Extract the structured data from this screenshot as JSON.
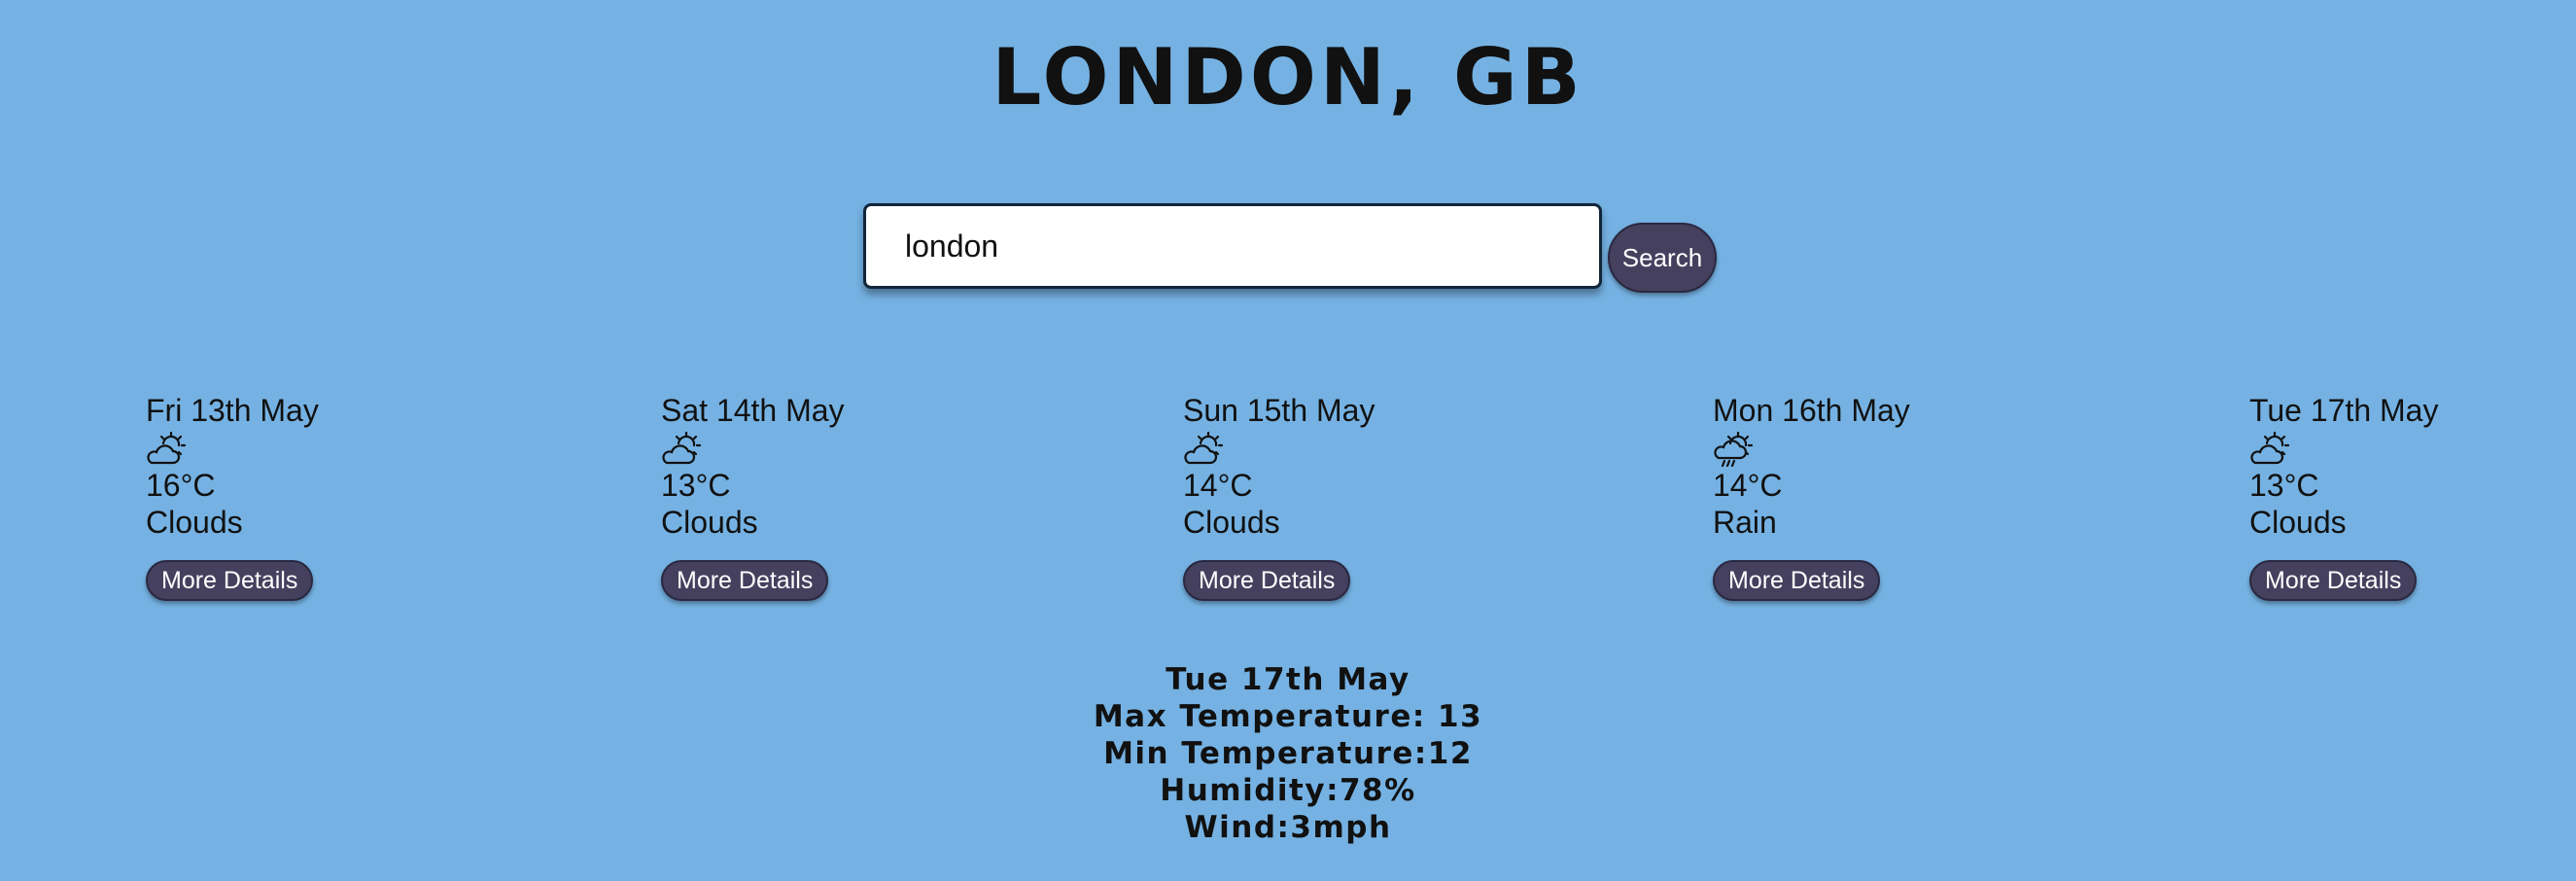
{
  "header": {
    "city_title": "LONDON, GB"
  },
  "search": {
    "value": "london",
    "button_label": "Search"
  },
  "forecast": [
    {
      "date": "Fri 13th May",
      "icon": "cloud-sun-icon",
      "temp": "16°C",
      "condition": "Clouds",
      "button_label": "More Details"
    },
    {
      "date": "Sat 14th May",
      "icon": "cloud-sun-icon",
      "temp": "13°C",
      "condition": "Clouds",
      "button_label": "More Details"
    },
    {
      "date": "Sun 15th May",
      "icon": "cloud-sun-icon",
      "temp": "14°C",
      "condition": "Clouds",
      "button_label": "More Details"
    },
    {
      "date": "Mon 16th May",
      "icon": "cloud-sun-rain-icon",
      "temp": "14°C",
      "condition": "Rain",
      "button_label": "More Details"
    },
    {
      "date": "Tue 17th May",
      "icon": "cloud-sun-icon",
      "temp": "13°C",
      "condition": "Clouds",
      "button_label": "More Details"
    }
  ],
  "details": {
    "date": "Tue 17th May",
    "max_temp": "Max Temperature: 13",
    "min_temp": "Min Temperature:12",
    "humidity": "Humidity:78%",
    "wind": "Wind:3mph"
  },
  "colors": {
    "background": "#75b2e3",
    "button": "#45405e",
    "button_text": "#ffffff"
  }
}
